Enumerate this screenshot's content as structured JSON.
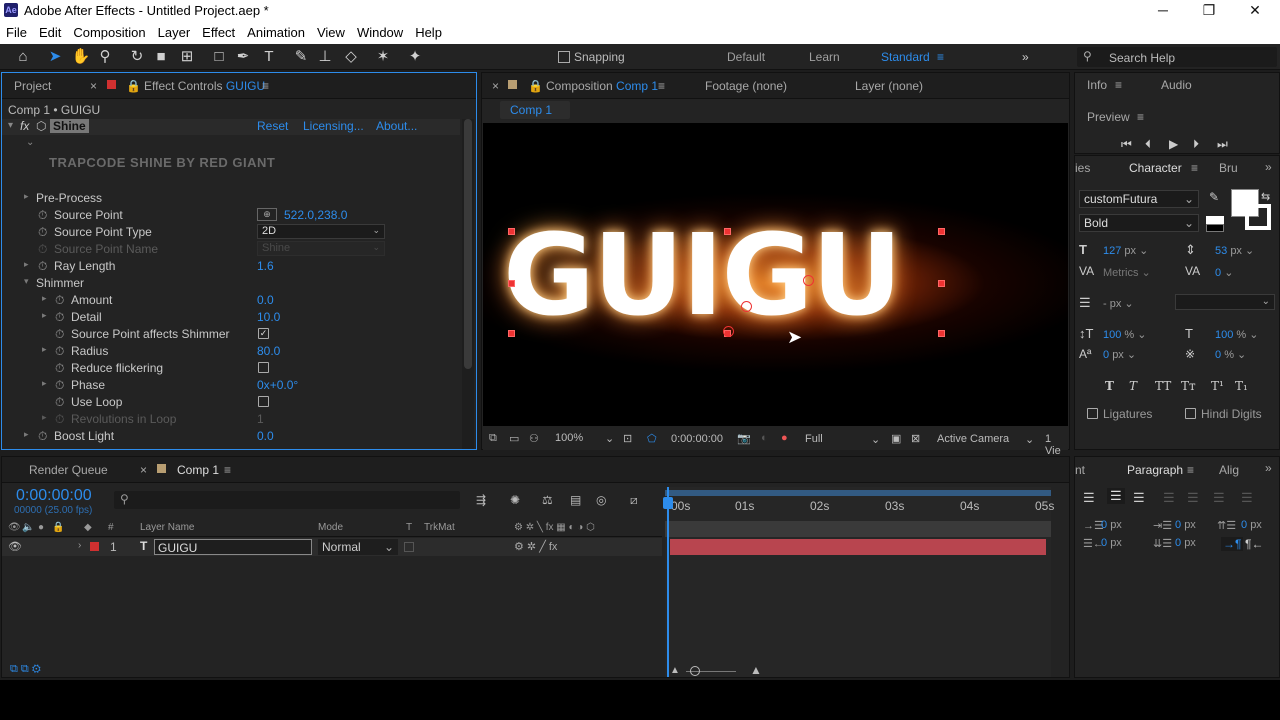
{
  "window": {
    "title": "Adobe After Effects - Untitled Project.aep *",
    "logo": "Ae"
  },
  "menu": [
    "File",
    "Edit",
    "Composition",
    "Layer",
    "Effect",
    "Animation",
    "View",
    "Window",
    "Help"
  ],
  "toolbar": {
    "snapping": "Snapping",
    "workspaces": [
      "Default",
      "Learn",
      "Standard"
    ],
    "search_placeholder": "Search Help"
  },
  "left_panel": {
    "tab_project": "Project",
    "tab_effect_controls": "Effect Controls",
    "tab_effect_layer": "GUIGU",
    "breadcrumb": "Comp 1 • GUIGU",
    "effect_name": "Shine",
    "reset": "Reset",
    "licensing": "Licensing...",
    "about": "About...",
    "banner": "TRAPCODE SHINE BY RED GIANT",
    "props": {
      "pre_process": "Pre-Process",
      "source_point": "Source Point",
      "source_point_val": "522.0,238.0",
      "source_point_type": "Source Point Type",
      "source_point_type_val": "2D",
      "source_point_name": "Source Point Name",
      "source_point_name_val": "Shine",
      "ray_length": "Ray Length",
      "ray_length_val": "1.6",
      "shimmer": "Shimmer",
      "amount": "Amount",
      "amount_val": "0.0",
      "detail": "Detail",
      "detail_val": "10.0",
      "spas": "Source Point affects Shimmer",
      "radius": "Radius",
      "radius_val": "80.0",
      "reduce_flickering": "Reduce flickering",
      "phase": "Phase",
      "phase_prefix": "0x",
      "phase_val": "+0.0°",
      "use_loop": "Use Loop",
      "revolutions": "Revolutions in Loop",
      "revolutions_val": "1",
      "boost_light": "Boost Light",
      "boost_light_val": "0.0"
    }
  },
  "comp_panel": {
    "tab_composition": "Composition",
    "tab_comp_name": "Comp 1",
    "footage": "Footage (none)",
    "layer": "Layer (none)",
    "comp_tab": "Comp 1",
    "text": "GUIGU",
    "zoom": "100%",
    "timecode": "0:00:00:00",
    "resolution": "Full",
    "camera": "Active Camera",
    "views": "1 Vie"
  },
  "right_panel": {
    "info": "Info",
    "audio": "Audio",
    "preview": "Preview",
    "tab_ies": "ies",
    "character": "Character",
    "tab_bru": "Bru",
    "font": "customFutura",
    "style": "Bold",
    "font_size": "127",
    "font_size_unit": "px",
    "leading": "53",
    "leading_unit": "px",
    "kerning": "Metrics",
    "tracking": "0",
    "stroke_unit": "- px",
    "vscale": "100",
    "hscale": "100",
    "pct": "%",
    "baseline": "0",
    "baseline_unit": "px",
    "tsume": "0",
    "tsume_unit": "%",
    "styles": [
      "T",
      "T",
      "TT",
      "Tт",
      "T¹",
      "T₁"
    ],
    "ligatures": "Ligatures",
    "hindi": "Hindi Digits",
    "tab_nt": "nt",
    "paragraph": "Paragraph",
    "tab_alig": "Alig",
    "para_vals": [
      "0",
      "0",
      "0",
      "0",
      "0"
    ],
    "px": "px"
  },
  "timeline": {
    "render_queue": "Render Queue",
    "comp_tab": "Comp 1",
    "timecode": "0:00:00:00",
    "fps": "00000 (25.00 fps)",
    "search_placeholder": "",
    "col_layer_name": "Layer Name",
    "col_mode": "Mode",
    "col_t": "T",
    "col_trkmat": "TrkMat",
    "col_hash": "#",
    "ruler": [
      "00s",
      "01s",
      "02s",
      "03s",
      "04s",
      "05s"
    ],
    "layer_num": "1",
    "layer_type": "T",
    "layer_name": "GUIGU",
    "layer_mode": "Normal"
  },
  "colors": {
    "accent": "#2d8ceb",
    "layer_bar": "#b8454f",
    "label_red": "#d03030"
  }
}
